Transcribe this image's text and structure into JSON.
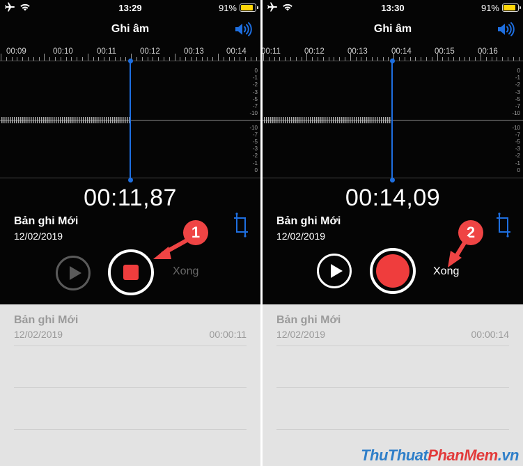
{
  "colors": {
    "accent": "#1e6fe0",
    "record_red": "#ef3d3d",
    "badge_red": "#ef4444",
    "battery_yellow": "#ffd60a",
    "watermark_blue": "#2f7fc9",
    "watermark_red": "#e23b3b"
  },
  "left": {
    "status": {
      "time": "13:29",
      "battery_pct": "91%",
      "battery_level": 0.91
    },
    "title": "Ghi âm",
    "ruler_labels": [
      "00:09",
      "00:10",
      "00:11",
      "00:12",
      "00:13",
      "00:14"
    ],
    "db_scale": [
      "0",
      "-1",
      "-2",
      "-3",
      "-5",
      "-7",
      "-10",
      "",
      "-10",
      "-7",
      "-5",
      "-3",
      "-2",
      "-1",
      "0"
    ],
    "timer": "00:11,87",
    "recording_name": "Bản ghi Mới",
    "recording_date": "12/02/2019",
    "done_label": "Xong",
    "list": {
      "name": "Bản ghi Mới",
      "date": "12/02/2019",
      "duration": "00:00:11"
    },
    "badge": "1"
  },
  "right": {
    "status": {
      "time": "13:30",
      "battery_pct": "91%",
      "battery_level": 0.91
    },
    "title": "Ghi âm",
    "ruler_labels": [
      "00:11",
      "00:12",
      "00:13",
      "00:14",
      "00:15",
      "00:16"
    ],
    "db_scale": [
      "0",
      "-1",
      "-2",
      "-3",
      "-5",
      "-7",
      "-10",
      "",
      "-10",
      "-7",
      "-5",
      "-3",
      "-2",
      "-1",
      "0"
    ],
    "timer": "00:14,09",
    "recording_name": "Bản ghi Mới",
    "recording_date": "12/02/2019",
    "done_label": "Xong",
    "list": {
      "name": "Bản ghi Mới",
      "date": "12/02/2019",
      "duration": "00:00:14"
    },
    "badge": "2"
  },
  "watermark": {
    "part1": "ThuThuat",
    "part2": "PhanMem",
    "part3": ".vn"
  }
}
